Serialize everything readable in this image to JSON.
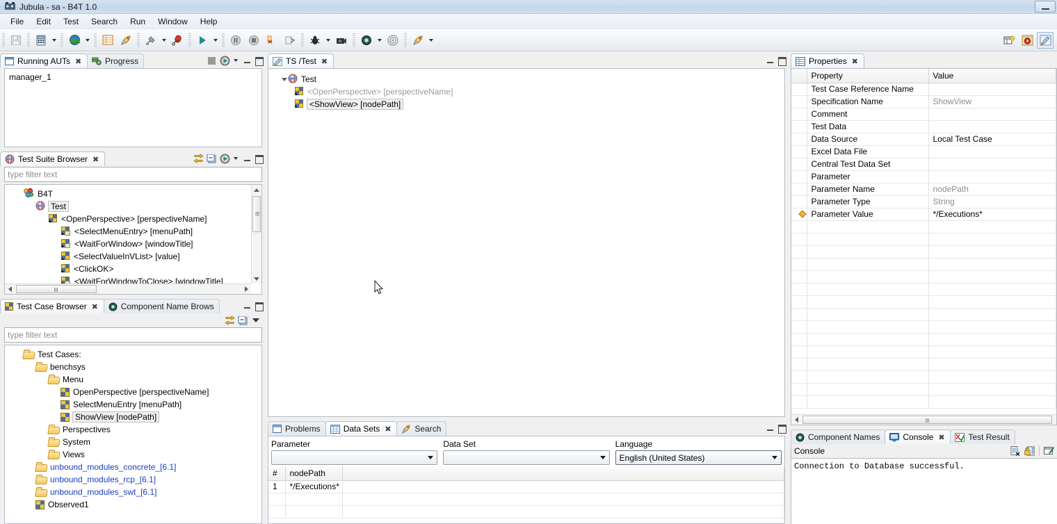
{
  "window": {
    "title": "Jubula - sa - B4T 1.0",
    "app_icon": "jubula-icon",
    "minimize_label": "–"
  },
  "menubar": {
    "items": [
      {
        "label": "File"
      },
      {
        "label": "Edit"
      },
      {
        "label": "Test"
      },
      {
        "label": "Search"
      },
      {
        "label": "Run"
      },
      {
        "label": "Window"
      },
      {
        "label": "Help"
      }
    ]
  },
  "toolbar": {
    "groups": [
      {
        "buttons": [
          {
            "icon": "save-icon",
            "name": "save-button",
            "disabled": true
          }
        ]
      },
      {
        "buttons": [
          {
            "icon": "calculator-icon",
            "name": "test-data-button",
            "dropdown": true
          }
        ]
      },
      {
        "buttons": [
          {
            "icon": "globe-icon",
            "name": "project-button",
            "dropdown": true
          }
        ]
      },
      {
        "buttons": [
          {
            "icon": "table-icon",
            "name": "data-sets-button"
          },
          {
            "icon": "rocket-icon",
            "name": "start-aut-button"
          }
        ]
      },
      {
        "buttons": [
          {
            "icon": "plug-icon",
            "name": "connect-aut-agent-button",
            "dropdown": true
          },
          {
            "icon": "record-icon",
            "name": "observe-button"
          }
        ]
      },
      {
        "buttons": [
          {
            "icon": "play-icon",
            "name": "run-test-suite-button",
            "dropdown": true
          }
        ]
      },
      {
        "buttons": [
          {
            "icon": "pause-icon",
            "name": "pause-test-button"
          },
          {
            "icon": "stop-icon",
            "name": "stop-test-button"
          },
          {
            "icon": "step-icon",
            "name": "step-button"
          },
          {
            "icon": "resume-icon",
            "name": "resume-button"
          }
        ]
      },
      {
        "buttons": [
          {
            "icon": "bug-icon",
            "name": "debug-button",
            "dropdown": true
          },
          {
            "icon": "camera-icon",
            "name": "screenshot-button"
          }
        ]
      },
      {
        "buttons": [
          {
            "icon": "target-icon",
            "name": "collect-component-names-button",
            "dropdown": true
          },
          {
            "icon": "target-grey-icon",
            "name": "stop-collect-button"
          }
        ]
      },
      {
        "buttons": [
          {
            "icon": "rocket-small-icon",
            "name": "aut-config-button",
            "dropdown": true
          }
        ]
      }
    ],
    "right_buttons": [
      {
        "icon": "new-perspective-icon",
        "name": "open-perspective-button"
      },
      {
        "icon": "gear-red-icon",
        "name": "jubula-perspective-button"
      },
      {
        "icon": "editor-pen-icon",
        "name": "test-editor-perspective-button"
      }
    ]
  },
  "running_auts": {
    "tabs": [
      {
        "label": "Running AUTs",
        "icon": "window-icon",
        "active": true,
        "closable": true
      },
      {
        "label": "Progress",
        "icon": "progress-icon",
        "active": false,
        "closable": false
      }
    ],
    "actions": [
      {
        "icon": "stop-square-icon",
        "name": "stop-aut-button"
      },
      {
        "icon": "play-green-icon",
        "name": "start-aut-button",
        "dropdown": true
      }
    ],
    "items": [
      "manager_1"
    ]
  },
  "test_suite_browser": {
    "tabs": [
      {
        "label": "Test Suite Browser",
        "icon": "test-suite-icon",
        "active": true,
        "closable": true
      }
    ],
    "actions": [
      {
        "icon": "link-editor-icon",
        "name": "link-with-editor-button"
      },
      {
        "icon": "collapse-all-icon",
        "name": "collapse-all-button"
      },
      {
        "icon": "play-green-icon",
        "name": "run-test-suite-button",
        "dropdown": true
      }
    ],
    "filter_placeholder": "type filter text",
    "tree": [
      {
        "label": "B4T",
        "icon": "project-icon",
        "indent": 0,
        "state": "normal"
      },
      {
        "label": "Test",
        "icon": "test-suite-icon",
        "indent": 1,
        "state": "selected"
      },
      {
        "label": "<OpenPerspective> [perspectiveName]",
        "icon": "tc-ref-icon",
        "indent": 2,
        "state": "normal"
      },
      {
        "label": "<SelectMenuEntry> [menuPath]",
        "icon": "tc-ref2-icon",
        "indent": 3,
        "state": "normal"
      },
      {
        "label": "<WaitForWindow> [windowTitle]",
        "icon": "tc-ref2-icon",
        "indent": 3,
        "state": "normal"
      },
      {
        "label": "<SelectValueInVList> [value]",
        "icon": "tc-ref-icon",
        "indent": 3,
        "state": "normal"
      },
      {
        "label": "<ClickOK>",
        "icon": "tc-ref-icon",
        "indent": 3,
        "state": "normal"
      },
      {
        "label": "<WaitForWindowToClose> [windowTitle]",
        "icon": "tc-ref2-icon",
        "indent": 3,
        "state": "normal"
      }
    ]
  },
  "test_case_browser": {
    "tabs": [
      {
        "label": "Test Case Browser",
        "icon": "tc-browser-icon",
        "active": true,
        "closable": true
      },
      {
        "label": "Component Name Brows",
        "icon": "component-names-icon",
        "active": false,
        "closable": false
      }
    ],
    "actions": [
      {
        "icon": "link-editor-icon",
        "name": "link-with-editor-button"
      },
      {
        "icon": "collapse-all-icon",
        "name": "collapse-all-button"
      },
      {
        "icon": "view-menu-icon",
        "name": "view-menu-button"
      }
    ],
    "filter_placeholder": "type filter text",
    "tree": [
      {
        "label": "Test Cases:",
        "icon": "folder-icon",
        "indent": 0,
        "state": "normal"
      },
      {
        "label": "benchsys",
        "icon": "folder-icon",
        "indent": 1,
        "state": "normal"
      },
      {
        "label": "Menu",
        "icon": "folder-icon",
        "indent": 2,
        "state": "normal"
      },
      {
        "label": "OpenPerspective [perspectiveName]",
        "icon": "quad-icon",
        "indent": 3,
        "state": "normal"
      },
      {
        "label": "SelectMenuEntry [menuPath]",
        "icon": "quad-icon",
        "indent": 3,
        "state": "normal"
      },
      {
        "label": "ShowView [nodePath]",
        "icon": "quad-icon",
        "indent": 3,
        "state": "selected"
      },
      {
        "label": "Perspectives",
        "icon": "folder-icon",
        "indent": 2,
        "state": "normal"
      },
      {
        "label": "System",
        "icon": "folder-icon",
        "indent": 2,
        "state": "normal"
      },
      {
        "label": "Views",
        "icon": "folder-icon",
        "indent": 2,
        "state": "normal"
      },
      {
        "label": "unbound_modules_concrete_[6.1]",
        "icon": "folder-icon",
        "indent": 1,
        "state": "link"
      },
      {
        "label": "unbound_modules_rcp_[6.1]",
        "icon": "folder-icon",
        "indent": 1,
        "state": "link"
      },
      {
        "label": "unbound_modules_swt_[6.1]",
        "icon": "folder-icon",
        "indent": 1,
        "state": "link"
      },
      {
        "label": "Observed1",
        "icon": "quad-icon",
        "indent": 1,
        "state": "normal"
      }
    ]
  },
  "editor": {
    "tabs": [
      {
        "label": "TS /Test",
        "icon": "editor-pen-icon",
        "active": true,
        "closable": true
      }
    ],
    "tree": [
      {
        "label": "Test",
        "icon": "test-suite-icon",
        "indent": 0,
        "state": "normal",
        "expander": "expanded"
      },
      {
        "label": "<OpenPerspective> [perspectiveName]",
        "icon": "tc-ref-icon",
        "indent": 1,
        "state": "greyed"
      },
      {
        "label": "<ShowView> [nodePath]",
        "icon": "tc-ref-icon",
        "indent": 1,
        "state": "selected"
      }
    ]
  },
  "properties": {
    "tabs": [
      {
        "label": "Properties",
        "icon": "properties-icon",
        "active": true,
        "closable": true
      }
    ],
    "columns": [
      "Property",
      "Value"
    ],
    "rows": [
      {
        "property": "Test Case Reference Name",
        "value": "",
        "value_grey": false,
        "marker": false
      },
      {
        "property": "Specification Name",
        "value": "ShowView",
        "value_grey": true,
        "marker": false
      },
      {
        "property": "Comment",
        "value": "",
        "value_grey": false,
        "marker": false
      },
      {
        "property": "Test Data",
        "value": "",
        "value_grey": false,
        "marker": false
      },
      {
        "property": "Data Source",
        "value": "Local Test Case",
        "value_grey": false,
        "marker": false
      },
      {
        "property": "Excel Data File",
        "value": "",
        "value_grey": false,
        "marker": false
      },
      {
        "property": "Central Test Data Set",
        "value": "",
        "value_grey": false,
        "marker": false
      },
      {
        "property": "Parameter",
        "value": "",
        "value_grey": false,
        "marker": false
      },
      {
        "property": "Parameter Name",
        "value": "nodePath",
        "value_grey": true,
        "marker": false
      },
      {
        "property": "Parameter Type",
        "value": "String",
        "value_grey": true,
        "marker": false
      },
      {
        "property": "Parameter Value",
        "value": "*/Executions*",
        "value_grey": false,
        "marker": true
      }
    ],
    "empty_rows": 15
  },
  "datasets": {
    "tabs": [
      {
        "label": "Problems",
        "icon": "problems-icon",
        "active": false,
        "closable": false
      },
      {
        "label": "Data Sets",
        "icon": "datasets-icon",
        "active": true,
        "closable": true
      },
      {
        "label": "Search",
        "icon": "search-icon",
        "active": false,
        "closable": false
      }
    ],
    "fields": [
      {
        "label": "Parameter",
        "value": "",
        "name": "parameter-combo"
      },
      {
        "label": "Data Set",
        "value": "",
        "name": "data-set-combo"
      },
      {
        "label": "Language",
        "value": "English (United States)",
        "name": "language-combo"
      }
    ],
    "columns": [
      "#",
      "nodePath",
      ""
    ],
    "rows": [
      {
        "index": "1",
        "value": "*/Executions*"
      }
    ],
    "empty_rows": 2
  },
  "console": {
    "tabs": [
      {
        "label": "Component Names",
        "icon": "component-names-icon",
        "active": false,
        "closable": false
      },
      {
        "label": "Console",
        "icon": "console-icon",
        "active": true,
        "closable": true
      },
      {
        "label": "Test Result",
        "icon": "test-result-icon",
        "active": false,
        "closable": false
      }
    ],
    "title": "Console",
    "actions": [
      {
        "icon": "clear-console-icon",
        "name": "clear-console-button"
      },
      {
        "icon": "lock-scroll-icon",
        "name": "scroll-lock-button"
      },
      {
        "icon": "open-console-icon",
        "name": "open-console-button"
      }
    ],
    "lines": [
      "Connection to Database successful."
    ]
  },
  "colors": {
    "accent_blue": "#1a3fbf",
    "selection_grey": "#f0f0f0",
    "greyed_text": "#9a9a9a",
    "tab_border": "#b8c0ca"
  }
}
